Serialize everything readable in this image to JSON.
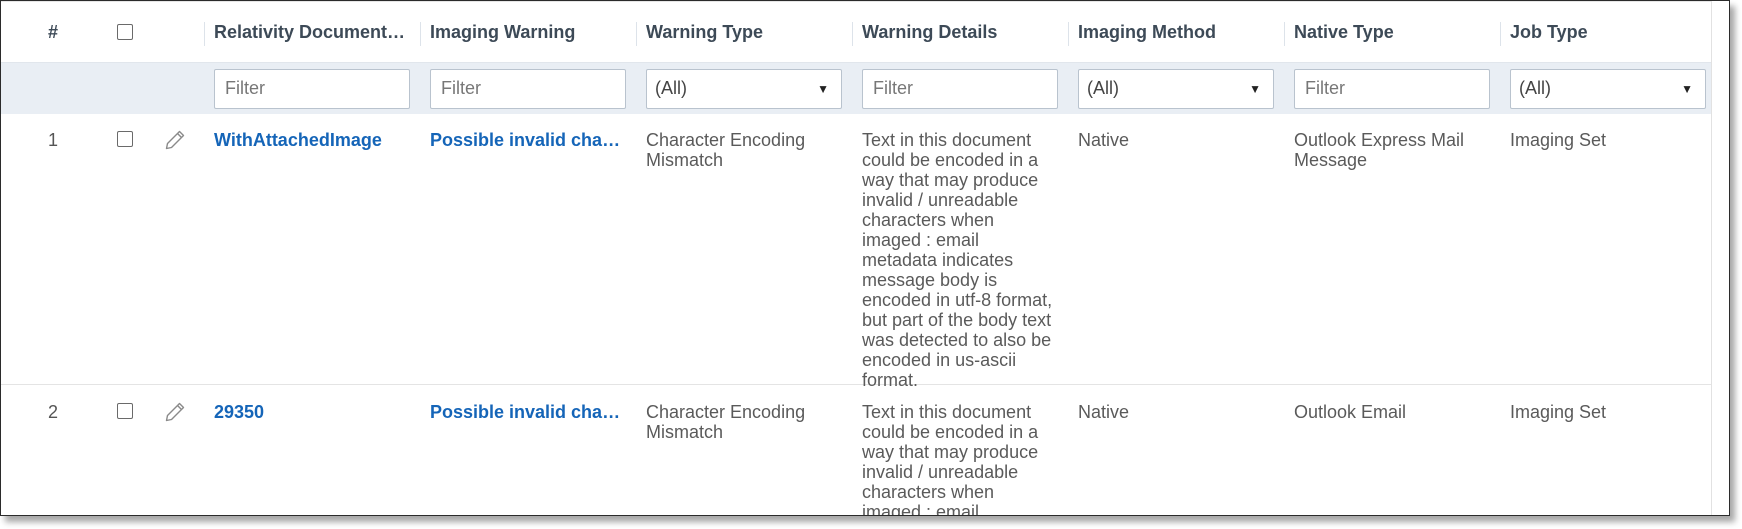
{
  "header": {
    "num": "#",
    "col1": "Relativity Document I...",
    "col2": "Imaging Warning",
    "col3": "Warning Type",
    "col4": "Warning Details",
    "col5": "Imaging Method",
    "col6": "Native Type",
    "col7": "Job Type"
  },
  "filters": {
    "col1_placeholder": "Filter",
    "col2_placeholder": "Filter",
    "col3_selected": "(All)",
    "col4_placeholder": "Filter",
    "col5_selected": "(All)",
    "col6_placeholder": "Filter",
    "col7_selected": "(All)"
  },
  "rows": [
    {
      "num": "1",
      "doc_id": "WithAttachedImage",
      "imaging_warning": "Possible invalid charac...",
      "warning_type": "Character Encoding Mismatch",
      "warning_details": "Text in this document could be encoded in a way that may produce invalid / unreadable characters when imaged : email metadata indicates message body is encoded in utf-8 format, but part of the body text was detected to also be encoded in us-ascii format.",
      "imaging_method": "Native",
      "native_type": "Outlook Express Mail Message",
      "job_type": "Imaging Set"
    },
    {
      "num": "2",
      "doc_id": "29350",
      "imaging_warning": "Possible invalid charac...",
      "warning_type": "Character Encoding Mismatch",
      "warning_details": "Text in this document could be encoded in a way that may produce invalid / unreadable characters when imaged : email metadata",
      "imaging_method": "Native",
      "native_type": "Outlook Email",
      "job_type": "Imaging Set"
    }
  ],
  "icons": {
    "edit": "pencil-icon",
    "dropdown": "caret-down-icon"
  },
  "colors": {
    "link": "#1565b8",
    "filter_row_bg": "#e9eef4",
    "header_text": "#3d4a57"
  }
}
